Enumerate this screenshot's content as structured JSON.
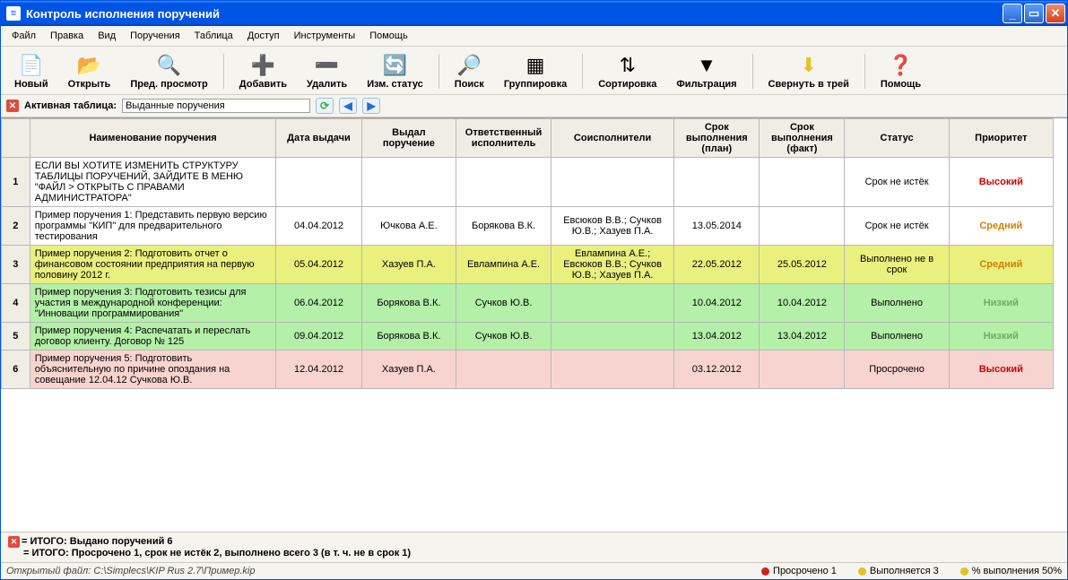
{
  "window": {
    "title": "Контроль исполнения поручений"
  },
  "menu": [
    "Файл",
    "Правка",
    "Вид",
    "Поручения",
    "Таблица",
    "Доступ",
    "Инструменты",
    "Помощь"
  ],
  "toolbar": [
    {
      "label": "Новый",
      "icon": "📄"
    },
    {
      "label": "Открыть",
      "icon": "📂"
    },
    {
      "label": "Пред. просмотр",
      "icon": "🔍"
    },
    {
      "sep": true
    },
    {
      "label": "Добавить",
      "icon": "➕",
      "color": "#3cb043"
    },
    {
      "label": "Удалить",
      "icon": "➖",
      "color": "#d04020"
    },
    {
      "label": "Изм. статус",
      "icon": "🔄",
      "color": "#3cb043"
    },
    {
      "sep": true
    },
    {
      "label": "Поиск",
      "icon": "🔎"
    },
    {
      "label": "Группировка",
      "icon": "▦"
    },
    {
      "sep": true
    },
    {
      "label": "Сортировка",
      "icon": "⇅"
    },
    {
      "label": "Фильтрация",
      "icon": "▼"
    },
    {
      "sep": true
    },
    {
      "label": "Свернуть в трей",
      "icon": "⬇",
      "color": "#e8c020"
    },
    {
      "sep": true
    },
    {
      "label": "Помощь",
      "icon": "❓",
      "color": "#2a8fd0"
    }
  ],
  "activebar": {
    "label": "Активная таблица:",
    "value": "Выданные поручения"
  },
  "table": {
    "columns": [
      "",
      "Наименование поручения",
      "Дата выдачи",
      "Выдал поручение",
      "Ответственный исполнитель",
      "Соисполнители",
      "Срок выполнения (план)",
      "Срок выполнения (факт)",
      "Статус",
      "Приоритет"
    ],
    "widths": [
      30,
      260,
      90,
      100,
      100,
      130,
      90,
      90,
      110,
      110
    ],
    "rows": [
      {
        "n": "1",
        "class": "",
        "cells": [
          "ЕСЛИ ВЫ ХОТИТЕ ИЗМЕНИТЬ СТРУКТУРУ ТАБЛИЦЫ ПОРУЧЕНИЙ, ЗАЙДИТЕ В МЕНЮ \"ФАЙЛ > ОТКРЫТЬ С ПРАВАМИ АДМИНИСТРАТОРА\"",
          "",
          "",
          "",
          "",
          "",
          "",
          "Срок не истёк"
        ],
        "prio": "Высокий",
        "prioClass": "prio-high"
      },
      {
        "n": "2",
        "class": "",
        "cells": [
          "Пример поручения 1: Представить первую версию программы \"КИП\" для предварительного тестирования",
          "04.04.2012",
          "Ючкова А.Е.",
          "Борякова В.К.",
          "Евсюков В.В.; Сучков Ю.В.; Хазуев П.А.",
          "13.05.2014",
          "",
          "Срок не истёк"
        ],
        "prio": "Средний",
        "prioClass": "prio-med"
      },
      {
        "n": "3",
        "class": "row-yellow",
        "cells": [
          "Пример поручения 2: Подготовить отчет о финансовом состоянии предприятия на первую половину 2012 г.",
          "05.04.2012",
          "Хазуев П.А.",
          "Евлампина А.Е.",
          "Евлампина А.Е.; Евсюков В.В.; Сучков Ю.В.; Хазуев П.А.",
          "22.05.2012",
          "25.05.2012",
          "Выполнено не в срок"
        ],
        "prio": "Средний",
        "prioClass": "prio-med"
      },
      {
        "n": "4",
        "class": "row-green",
        "cells": [
          "Пример поручения 3: Подготовить тезисы для участия в международной конференции: \"Инновации программирования\"",
          "06.04.2012",
          "Борякова В.К.",
          "Сучков Ю.В.",
          "",
          "10.04.2012",
          "10.04.2012",
          "Выполнено"
        ],
        "prio": "Низкий",
        "prioClass": "prio-low"
      },
      {
        "n": "5",
        "class": "row-green",
        "cells": [
          "Пример поручения 4: Распечатать и переслать договор клиенту. Договор № 125",
          "09.04.2012",
          "Борякова В.К.",
          "Сучков Ю.В.",
          "",
          "13.04.2012",
          "13.04.2012",
          "Выполнено"
        ],
        "prio": "Низкий",
        "prioClass": "prio-low"
      },
      {
        "n": "6",
        "class": "row-pink",
        "cells": [
          "Пример поручения 5: Подготовить объяснительную по причине опоздания на совещание 12.04.12 Сучкова Ю.В.",
          "12.04.2012",
          "Хазуев П.А.",
          "",
          "",
          "03.12.2012",
          "",
          "Просрочено"
        ],
        "prio": "Высокий",
        "prioClass": "prio-high"
      }
    ]
  },
  "summary": {
    "line1": "= ИТОГО: Выдано поручений 6",
    "line2": "= ИТОГО: Просрочено 1, срок не истёк 2, выполнено всего 3 (в т. ч. не в срок 1)"
  },
  "status": {
    "file_label": "Открытый файл:",
    "file_path": "C:\\Simplecs\\KIP Rus 2.7\\Пример.kip",
    "ind1": "Просрочено 1",
    "ind2": "Выполняется 3",
    "ind3": "% выполнения 50%"
  }
}
